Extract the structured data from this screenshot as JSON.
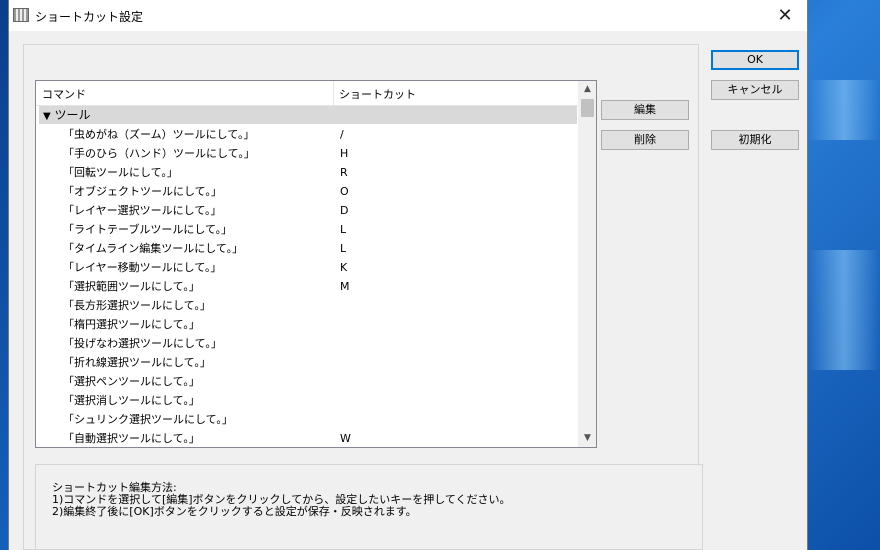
{
  "window": {
    "title": "ショートカット設定",
    "close_glyph": "✕"
  },
  "list": {
    "headers": {
      "command": "コマンド",
      "shortcut": "ショートカット"
    },
    "group": {
      "arrow": "▼",
      "label": "ツール"
    },
    "rows": [
      {
        "command": "「虫めがね（ズーム）ツールにして。」",
        "shortcut": "/"
      },
      {
        "command": "「手のひら（ハンド）ツールにして。」",
        "shortcut": "H"
      },
      {
        "command": "「回転ツールにして。」",
        "shortcut": "R"
      },
      {
        "command": "「オブジェクトツールにして。」",
        "shortcut": "O"
      },
      {
        "command": "「レイヤー選択ツールにして。」",
        "shortcut": "D"
      },
      {
        "command": "「ライトテーブルツールにして。」",
        "shortcut": "L"
      },
      {
        "command": "「タイムライン編集ツールにして。」",
        "shortcut": "L"
      },
      {
        "command": "「レイヤー移動ツールにして。」",
        "shortcut": "K"
      },
      {
        "command": "「選択範囲ツールにして。」",
        "shortcut": "M"
      },
      {
        "command": "「長方形選択ツールにして。」",
        "shortcut": ""
      },
      {
        "command": "「楕円選択ツールにして。」",
        "shortcut": ""
      },
      {
        "command": "「投げなわ選択ツールにして。」",
        "shortcut": ""
      },
      {
        "command": "「折れ線選択ツールにして。」",
        "shortcut": ""
      },
      {
        "command": "「選択ペンツールにして。」",
        "shortcut": ""
      },
      {
        "command": "「選択消しツールにして。」",
        "shortcut": ""
      },
      {
        "command": "「シュリンク選択ツールにして。」",
        "shortcut": ""
      },
      {
        "command": "「自動選択ツールにして。」",
        "shortcut": "W"
      }
    ]
  },
  "buttons": {
    "edit": "編集",
    "delete": "削除",
    "ok": "OK",
    "cancel": "キャンセル",
    "reset": "初期化"
  },
  "info": {
    "title": "ショートカット編集方法:",
    "line1": " 1)コマンドを選択して[編集]ボタンをクリックしてから、設定したいキーを押してください。",
    "line2": " 2)編集終了後に[OK]ボタンをクリックすると設定が保存・反映されます。"
  },
  "icons": {
    "scroll_up": "▲",
    "scroll_down": "▼"
  }
}
